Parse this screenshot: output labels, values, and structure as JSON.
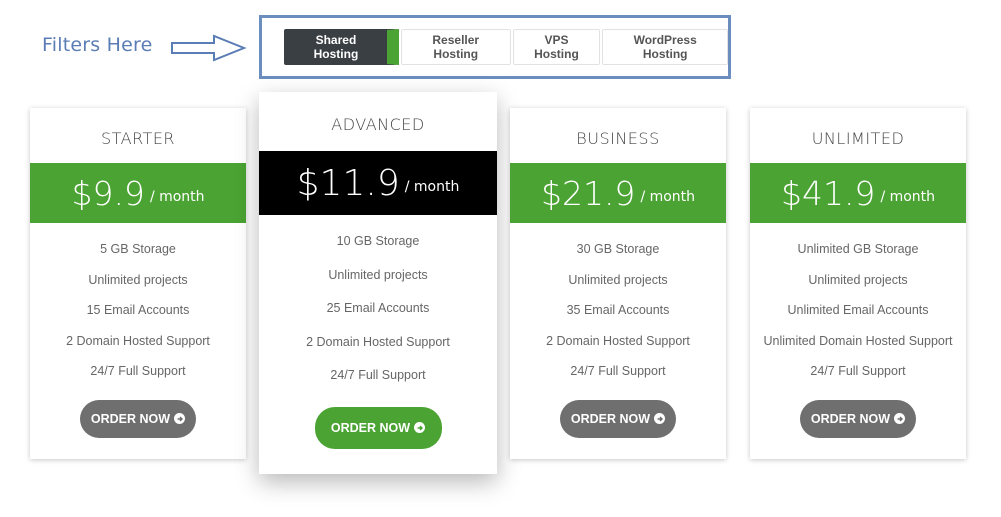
{
  "annotation": {
    "text": "Filters Here"
  },
  "filters": {
    "items": [
      {
        "label": "Shared Hosting",
        "active": true
      },
      {
        "label": "Reseller Hosting",
        "active": false
      },
      {
        "label": "VPS Hosting",
        "active": false
      },
      {
        "label": "WordPress Hosting",
        "active": false
      }
    ]
  },
  "colors": {
    "accent": "#4aa332",
    "dark_band": "#000000",
    "button_gray": "#6f6f6f",
    "filter_active": "#3a3f44",
    "annotation": "#5a7db5"
  },
  "plans": [
    {
      "name": "STARTER",
      "price": "$9.9",
      "period": "/ month",
      "features": [
        "5 GB Storage",
        "Unlimited projects",
        "15 Email Accounts",
        "2 Domain Hosted Support",
        "24/7 Full Support"
      ],
      "button": "ORDER NOW"
    },
    {
      "name": "ADVANCED",
      "price": "$11.9",
      "period": "/ month",
      "features": [
        "10 GB Storage",
        "Unlimited projects",
        "25 Email Accounts",
        "2 Domain Hosted Support",
        "24/7 Full Support"
      ],
      "button": "ORDER NOW"
    },
    {
      "name": "BUSINESS",
      "price": "$21.9",
      "period": "/ month",
      "features": [
        "30 GB Storage",
        "Unlimited projects",
        "35 Email Accounts",
        "2 Domain Hosted Support",
        "24/7 Full Support"
      ],
      "button": "ORDER NOW"
    },
    {
      "name": "UNLIMITED",
      "price": "$41.9",
      "period": "/ month",
      "features": [
        "Unlimited GB Storage",
        "Unlimited projects",
        "Unlimited Email Accounts",
        "Unlimited Domain Hosted Support",
        "24/7 Full Support"
      ],
      "button": "ORDER NOW"
    }
  ]
}
